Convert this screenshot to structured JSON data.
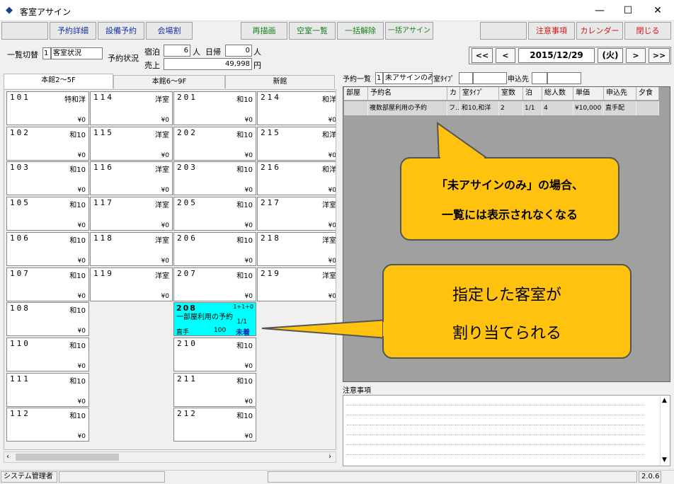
{
  "window": {
    "title": "客室アサイン"
  },
  "toolbar": {
    "reservation_detail": "予約詳細",
    "equipment_booking": "設備予約",
    "venue_split": "会場割",
    "redraw": "再描画",
    "vacancy_list": "空室一覧",
    "bulk_release": "一括解除",
    "bulk_assign": "一括アサイン",
    "notice": "注意事項",
    "calendar": "カレンダー",
    "close": "閉じる"
  },
  "filters": {
    "list_switch_label": "一覧切替",
    "list_switch_num": "1",
    "list_switch_value": "客室状況",
    "booking_status_label": "予約状況",
    "stay_label": "宿泊",
    "stay_value": "6",
    "stay_unit": "人",
    "daytrip_label": "日帰",
    "daytrip_value": "0",
    "daytrip_unit": "人",
    "sales_label": "売上",
    "sales_value": "49,998",
    "sales_unit": "円"
  },
  "date_nav": {
    "first": "<<",
    "prev": "<",
    "date": "2015/12/29",
    "weekday": "(火)",
    "next": ">",
    "last": ">>"
  },
  "tabs": [
    "本館2～5F",
    "本館6～9F",
    "新館"
  ],
  "rooms": [
    {
      "num": "101",
      "type": "特和洋",
      "price": "¥0",
      "col": 0,
      "row": 0
    },
    {
      "num": "102",
      "type": "和10",
      "price": "¥0",
      "col": 0,
      "row": 1
    },
    {
      "num": "103",
      "type": "和10",
      "price": "¥0",
      "col": 0,
      "row": 2
    },
    {
      "num": "105",
      "type": "和10",
      "price": "¥0",
      "col": 0,
      "row": 3
    },
    {
      "num": "106",
      "type": "和10",
      "price": "¥0",
      "col": 0,
      "row": 4
    },
    {
      "num": "107",
      "type": "和10",
      "price": "¥0",
      "col": 0,
      "row": 5
    },
    {
      "num": "108",
      "type": "和10",
      "price": "¥0",
      "col": 0,
      "row": 6
    },
    {
      "num": "110",
      "type": "和10",
      "price": "¥0",
      "col": 0,
      "row": 7
    },
    {
      "num": "111",
      "type": "和10",
      "price": "¥0",
      "col": 0,
      "row": 8
    },
    {
      "num": "112",
      "type": "和10",
      "price": "¥0",
      "col": 0,
      "row": 9
    },
    {
      "num": "114",
      "type": "洋室",
      "price": "¥0",
      "col": 1,
      "row": 0
    },
    {
      "num": "115",
      "type": "洋室",
      "price": "¥0",
      "col": 1,
      "row": 1
    },
    {
      "num": "116",
      "type": "洋室",
      "price": "¥0",
      "col": 1,
      "row": 2
    },
    {
      "num": "117",
      "type": "洋室",
      "price": "¥0",
      "col": 1,
      "row": 3
    },
    {
      "num": "118",
      "type": "洋室",
      "price": "¥0",
      "col": 1,
      "row": 4
    },
    {
      "num": "119",
      "type": "洋室",
      "price": "¥0",
      "col": 1,
      "row": 5
    },
    {
      "num": "201",
      "type": "和10",
      "price": "¥0",
      "col": 2,
      "row": 0
    },
    {
      "num": "202",
      "type": "和10",
      "price": "¥0",
      "col": 2,
      "row": 1
    },
    {
      "num": "203",
      "type": "和10",
      "price": "¥0",
      "col": 2,
      "row": 2
    },
    {
      "num": "205",
      "type": "和10",
      "price": "¥0",
      "col": 2,
      "row": 3
    },
    {
      "num": "206",
      "type": "和10",
      "price": "¥0",
      "col": 2,
      "row": 4
    },
    {
      "num": "207",
      "type": "和10",
      "price": "¥0",
      "col": 2,
      "row": 5
    },
    {
      "num": "210",
      "type": "和10",
      "price": "¥0",
      "col": 2,
      "row": 7
    },
    {
      "num": "211",
      "type": "和10",
      "price": "¥0",
      "col": 2,
      "row": 8
    },
    {
      "num": "212",
      "type": "和10",
      "price": "¥0",
      "col": 2,
      "row": 9
    },
    {
      "num": "214",
      "type": "和洋",
      "price": "¥0",
      "col": 3,
      "row": 0
    },
    {
      "num": "215",
      "type": "和洋",
      "price": "¥0",
      "col": 3,
      "row": 1
    },
    {
      "num": "216",
      "type": "和洋",
      "price": "¥0",
      "col": 3,
      "row": 2
    },
    {
      "num": "217",
      "type": "洋室",
      "price": "¥0",
      "col": 3,
      "row": 3
    },
    {
      "num": "218",
      "type": "洋室",
      "price": "¥0",
      "col": 3,
      "row": 4
    },
    {
      "num": "219",
      "type": "洋室",
      "price": "¥0",
      "col": 3,
      "row": 5
    }
  ],
  "assigned_room": {
    "num": "208",
    "guests": "1+1+0",
    "name": "一部屋利用の予約",
    "nights": "1/1",
    "channel": "直手",
    "amount": "100",
    "status": "未着",
    "col": 2,
    "row": 6
  },
  "reservation_list": {
    "label": "予約一覧",
    "filter_num": "1",
    "filter_value": "未アサインのみ",
    "room_type_label": "室ﾀｲﾌﾟ",
    "applicant_label": "申込先",
    "columns": [
      "部屋",
      "予約名",
      "カ",
      "室ﾀｲﾌﾟ",
      "室数",
      "泊",
      "総人数",
      "単価",
      "申込先",
      "夕食"
    ],
    "rows": [
      [
        "",
        "複数部屋利用の予約",
        "フ..",
        "和10,和洋",
        "2",
        "1/1",
        "4",
        "¥10,000",
        "直手配",
        ""
      ]
    ]
  },
  "notes": {
    "label": "注意事項"
  },
  "callouts": {
    "top_line1": "「未アサインのみ」の場合、",
    "top_line2": "一覧には表示されなくなる",
    "bottom_line1": "指定した客室が",
    "bottom_line2": "割り当てられる"
  },
  "status": {
    "user": "システム管理者",
    "version": "2.0.6"
  },
  "colors": {
    "assigned_highlight": "#00ffff",
    "callout": "#ffc20e",
    "link_blue": "#1531a8",
    "link_green": "#1a7f1a",
    "link_red": "#d01515"
  }
}
